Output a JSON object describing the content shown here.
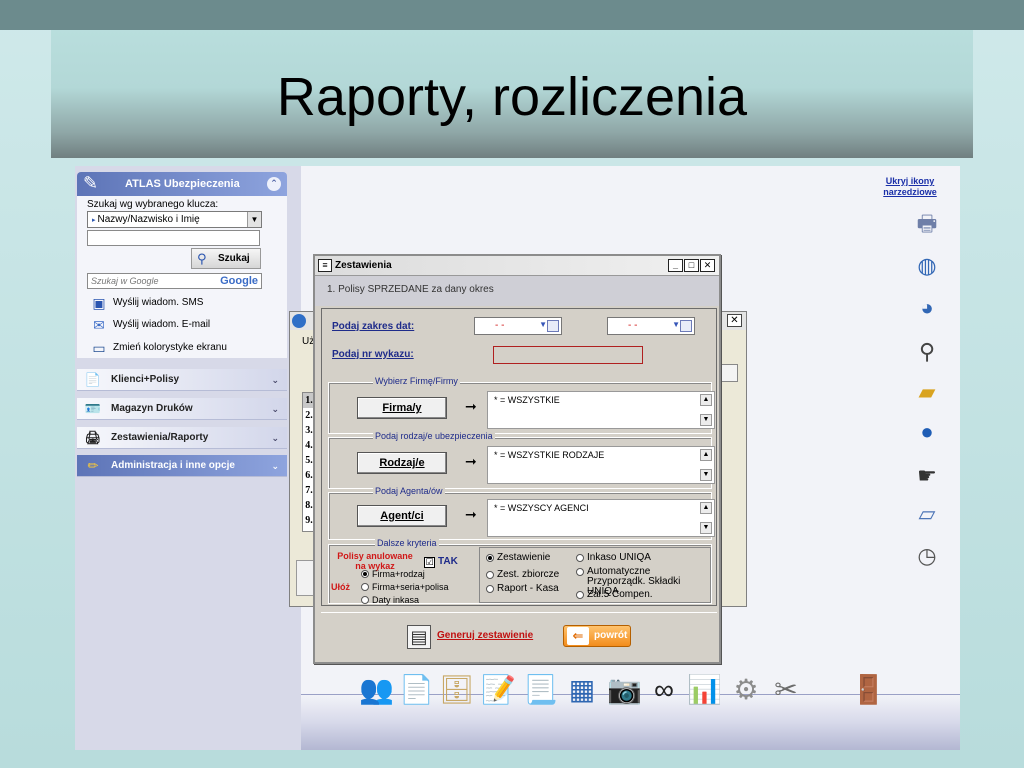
{
  "slide": {
    "title": "Raporty, rozliczenia"
  },
  "left_panel": {
    "header": "ATLAS Ubezpieczenia",
    "search_label": "Szukaj wg wybranego klucza:",
    "key_select_value": "Nazwy/Nazwisko i Imię",
    "search_button": "Szukaj",
    "google_placeholder": "Szukaj w Google",
    "google_logo": "Google",
    "links": [
      "Wyślij wiadom. SMS",
      "Wyślij wiadom. E-mail",
      "Zmień kolorystyke ekranu"
    ],
    "sections": [
      "Klienci+Polisy",
      "Magazyn Druków",
      "Zestawienia/Raporty",
      "Administracja i inne opcje"
    ]
  },
  "tools": {
    "hide_link": "Ukryj ikony narzedziowe",
    "icons": [
      "printer-icon",
      "globe-lock-icon",
      "globe-up-icon",
      "magnifier-icon",
      "folder-arrow-icon",
      "globe-icon",
      "hand-pointer-icon",
      "credit-card-icon",
      "clock-icon"
    ]
  },
  "back_window": {
    "label": "Uż",
    "rows": [
      "1.",
      "2.",
      "3.",
      "4.",
      "5.",
      "6.",
      "7.",
      "8.",
      "9."
    ]
  },
  "dialog": {
    "title": "Zestawienia",
    "subtitle": "1. Polisy SPRZEDANE za dany okres",
    "date_range_label": "Podaj zakres dat:",
    "date_from": "- -",
    "date_to": "- -",
    "list_number_label": "Podaj nr wykazu:",
    "groups": [
      {
        "legend": "Wybierz Firmę/Firmy",
        "button": "Firma/y",
        "value": "* = WSZYSTKIE"
      },
      {
        "legend": "Podaj rodzaj/e ubezpieczenia",
        "button": "Rodzaj/e",
        "value": "* = WSZYSTKIE RODZAJE"
      },
      {
        "legend": "Podaj Agenta/ów",
        "button": "Agent/ci",
        "value": "* = WSZYSCY AGENCI"
      }
    ],
    "more_criteria": {
      "legend": "Dalsze kryteria",
      "cancelled_label_1": "Polisy anulowane",
      "cancelled_label_2": "na wykaz",
      "tak_label": "TAK",
      "tak_checked": "☑",
      "uloz_label": "Ułóż",
      "sort_options": [
        {
          "label": "Firma+rodzaj",
          "checked": true
        },
        {
          "label": "Firma+seria+polisa",
          "checked": false
        },
        {
          "label": "Daty inkasa",
          "checked": false
        }
      ],
      "report_options": [
        {
          "label": "Zestawienie",
          "checked": true
        },
        {
          "label": "Inkaso UNIQA",
          "checked": false
        },
        {
          "label": "Zest. zbiorcze",
          "checked": false
        },
        {
          "label": "Automatyczne Przyporządk. Składki UNIQA",
          "checked": false
        },
        {
          "label": "Raport - Kasa",
          "checked": false
        },
        {
          "label": "Zał.5 Compen.",
          "checked": false
        }
      ]
    },
    "generate_button": "Generuj zestawienie",
    "back_button": "powrót"
  },
  "bottom_toolbar": {
    "icons": [
      "clients-icon",
      "document-user-icon",
      "cabinet-icon",
      "notepad-pen-icon",
      "report-icon",
      "spreadsheet-icon",
      "camera-icon",
      "binoculars-icon",
      "chart-doc-icon",
      "settings-icon",
      "tools-icon",
      "exit-door-icon"
    ]
  },
  "colors": {
    "accent": "#5d74b7",
    "link": "#1a2fa8",
    "alert_red": "#d01818"
  }
}
